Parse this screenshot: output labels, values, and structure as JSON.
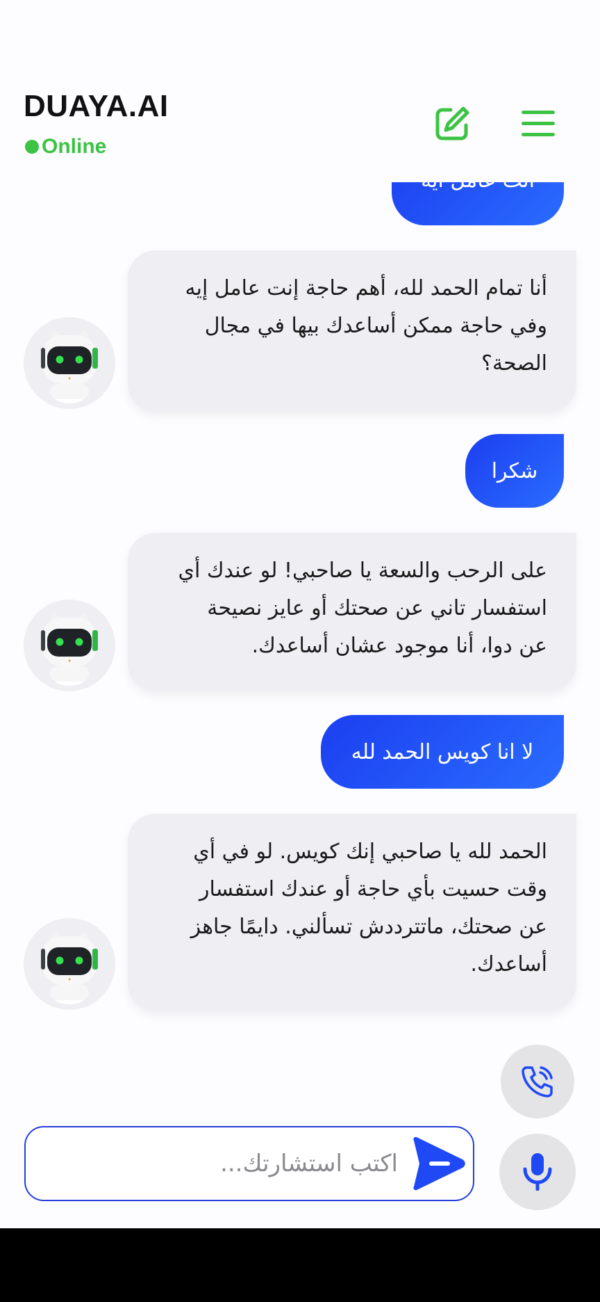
{
  "header": {
    "title": "DUAYA.AI",
    "status": "Online",
    "edit_icon": "edit-note-icon",
    "menu_icon": "hamburger-menu-icon"
  },
  "messages": [
    {
      "role": "user",
      "text": "انت عامل ايه"
    },
    {
      "role": "bot",
      "lines": [
        "أنا تمام الحمد لله، أهم حاجة إنت عامل إيه",
        "وفي حاجة ممكن أساعدك بيها في مجال",
        "الصحة؟"
      ]
    },
    {
      "role": "user",
      "text": "شكرا"
    },
    {
      "role": "bot",
      "lines": [
        "على الرحب والسعة يا صاحبي! لو عندك أي",
        "استفسار تاني عن صحتك أو عايز نصيحة",
        "عن دوا، أنا موجود عشان أساعدك."
      ]
    },
    {
      "role": "user",
      "text": "لا انا كويس الحمد لله"
    },
    {
      "role": "bot",
      "lines": [
        "الحمد لله يا صاحبي إنك كويس. لو في أي",
        "وقت حسيت بأي حاجة أو عندك استفسار",
        "عن صحتك، ماتترددش تسألني. دايمًا جاهز",
        "أساعدك."
      ]
    }
  ],
  "composer": {
    "placeholder": "اكتب استشارتك...",
    "value": ""
  },
  "colors": {
    "accent": "#1f49f5",
    "online": "#3cc344",
    "bot_bubble": "#efeef3"
  }
}
